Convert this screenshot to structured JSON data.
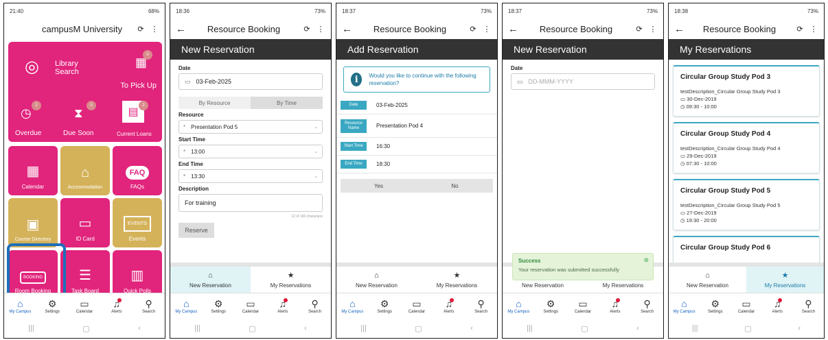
{
  "screens": [
    {
      "status": {
        "time": "21:40",
        "right": "68%"
      },
      "header": {
        "title": "campusM University"
      },
      "tiles": {
        "library": "Library Search",
        "library_line2": "Search",
        "to_pick_up": "To Pick Up",
        "to_pick_up_count": "0",
        "overdue": "Overdue",
        "overdue_count": "2",
        "due_soon": "Due Soon",
        "due_soon_count": "0",
        "current_loans": "Current Loans",
        "current_loans_count": "2",
        "calendar": "Calendar",
        "accommodation": "Accommodation",
        "faqs": "FAQs",
        "faq_icon": "FAQ",
        "course_directory": "Course Directory",
        "id_card": "ID Card",
        "events": "Events",
        "events_icon": "EVENTS",
        "room_booking": "Room Booking",
        "room_booking_icon": "BOOKING",
        "task_board": "Task Board",
        "quick_polls": "Quick Polls"
      }
    },
    {
      "status": {
        "time": "18:36",
        "right": "73%"
      },
      "title": "Resource Booking",
      "section": "New Reservation",
      "date_label": "Date",
      "date_value": "03-Feb-2025",
      "by_resource": "By Resource",
      "by_time": "By Time",
      "resource_label": "Resource",
      "resource_value": "Presentation Pod 5",
      "start_label": "Start Time",
      "start_value": "13:00",
      "end_label": "End Time",
      "end_value": "13:30",
      "desc_label": "Description",
      "desc_value": "For training",
      "counter": "12 of 160 characters",
      "reserve": "Reserve"
    },
    {
      "status": {
        "time": "18:37",
        "right": "73%"
      },
      "title": "Resource Booking",
      "section": "Add Reservation",
      "confirm_msg": "Would you like to continue with the following reservation?",
      "rows": [
        {
          "k": "Date",
          "v": "03-Feb-2025"
        },
        {
          "k": "Resource Name",
          "v": "Presentation Pod 4"
        },
        {
          "k": "Start Time",
          "v": "16:30"
        },
        {
          "k": "End Time",
          "v": "18:30"
        }
      ],
      "yes": "Yes",
      "no": "No"
    },
    {
      "status": {
        "time": "18:37",
        "right": "73%"
      },
      "title": "Resource Booking",
      "section": "New Reservation",
      "date_label": "Date",
      "date_placeholder": "DD-MMM-YYYY",
      "toast_title": "Success",
      "toast_msg": "Your reservation was submitted successfully"
    },
    {
      "status": {
        "time": "18:38",
        "right": "73%"
      },
      "title": "Resource Booking",
      "section": "My Reservations",
      "cards": [
        {
          "title": "Circular Group Study Pod 3",
          "desc": "testDescription_Circular Group Study Pod 3",
          "date": "30-Dec-2019",
          "time": "09:30 - 10:00"
        },
        {
          "title": "Circular Group Study Pod 4",
          "desc": "testDescription_Circular Group Study Pod 4",
          "date": "29-Dec-2019",
          "time": "07:30 - 10:00"
        },
        {
          "title": "Circular Group Study Pod 5",
          "desc": "testDescription_Circular Group Study Pod 5",
          "date": "27-Dec-2019",
          "time": "19:30 - 20:00"
        },
        {
          "title": "Circular Group Study Pod 6"
        }
      ]
    }
  ],
  "tabs": {
    "new": "New Reservation",
    "mine": "My Reservations"
  },
  "nav": {
    "my_campus": "My Campus",
    "settings": "Settings",
    "calendar": "Calendar",
    "alerts": "Alerts",
    "search": "Search"
  },
  "colors": {
    "pink": "#e1247c",
    "gold": "#d4b25a",
    "teal": "#3aa8c2",
    "header": "#333333",
    "highlight": "#1d6fb8"
  }
}
